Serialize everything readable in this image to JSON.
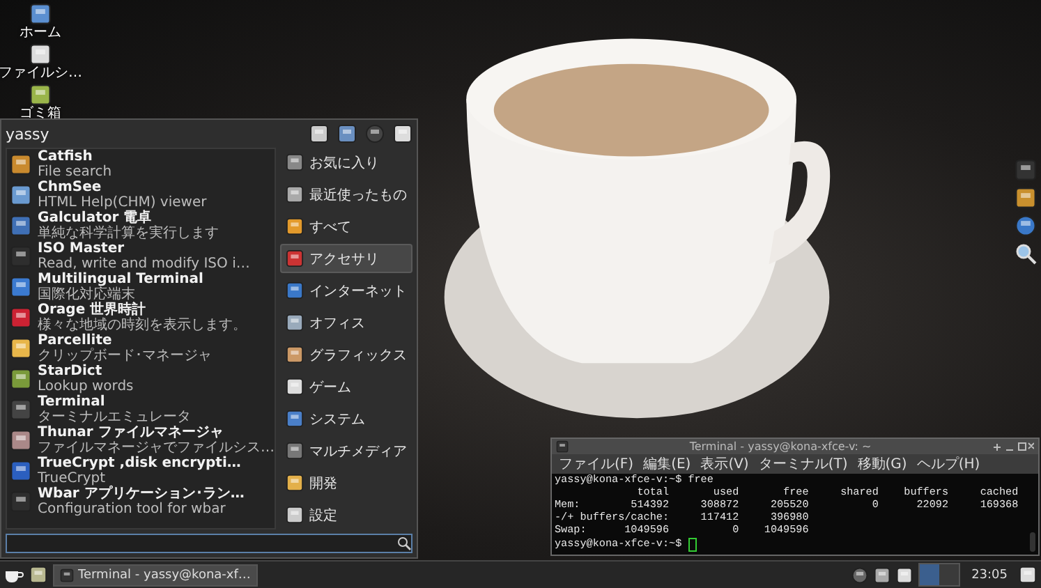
{
  "desktop_icons": [
    {
      "label": "ホーム"
    },
    {
      "label": "ファイルシ…"
    },
    {
      "label": "ゴミ箱"
    }
  ],
  "app_menu": {
    "user": "yassy",
    "apps": [
      {
        "name": "Catfish",
        "description": "File search"
      },
      {
        "name": "ChmSee",
        "description": "HTML Help(CHM) viewer"
      },
      {
        "name": "Galculator 電卓",
        "description": "単純な科学計算を実行します"
      },
      {
        "name": "ISO Master",
        "description": "Read, write and modify ISO i…"
      },
      {
        "name": "Multilingual Terminal",
        "description": "国際化対応端末"
      },
      {
        "name": "Orage 世界時計",
        "description": "様々な地域の時刻を表示します。"
      },
      {
        "name": "Parcellite",
        "description": "クリップボード･マネージャ"
      },
      {
        "name": "StarDict",
        "description": "Lookup words"
      },
      {
        "name": "Terminal",
        "description": "ターミナルエミュレータ"
      },
      {
        "name": "Thunar ファイルマネージャ",
        "description": "ファイルマネージャでファイルシス…"
      },
      {
        "name": "TrueCrypt ,disk encrypti…",
        "description": "TrueCrypt"
      },
      {
        "name": "Wbar アプリケーション･ラン…",
        "description": "Configuration tool for wbar"
      }
    ],
    "categories": [
      {
        "label": "お気に入り",
        "selected": false
      },
      {
        "label": "最近使ったもの",
        "selected": false
      },
      {
        "label": "すべて",
        "selected": false
      },
      {
        "label": "アクセサリ",
        "selected": true
      },
      {
        "label": "インターネット",
        "selected": false
      },
      {
        "label": "オフィス",
        "selected": false
      },
      {
        "label": "グラフィックス",
        "selected": false
      },
      {
        "label": "ゲーム",
        "selected": false
      },
      {
        "label": "システム",
        "selected": false
      },
      {
        "label": "マルチメディア",
        "selected": false
      },
      {
        "label": "開発",
        "selected": false
      },
      {
        "label": "設定",
        "selected": false
      }
    ]
  },
  "terminal": {
    "title": "Terminal - yassy@kona-xfce-v: ~",
    "menu": [
      "ファイル(F)",
      "編集(E)",
      "表示(V)",
      "ターミナル(T)",
      "移動(G)",
      "ヘルプ(H)"
    ],
    "lines": [
      "yassy@kona-xfce-v:~$ free",
      "             total       used       free     shared    buffers     cached",
      "Mem:        514392     308872     205520          0      22092     169368",
      "-/+ buffers/cache:     117412     396980",
      "Swap:      1049596          0    1049596",
      "yassy@kona-xfce-v:~$ "
    ]
  },
  "taskbar": {
    "tasks": [
      {
        "label": "Terminal - yassy@kona-xf…",
        "selected": true
      }
    ],
    "workspaces": [
      {
        "selected": true
      },
      {
        "selected": false
      }
    ],
    "clock": "23:05"
  }
}
